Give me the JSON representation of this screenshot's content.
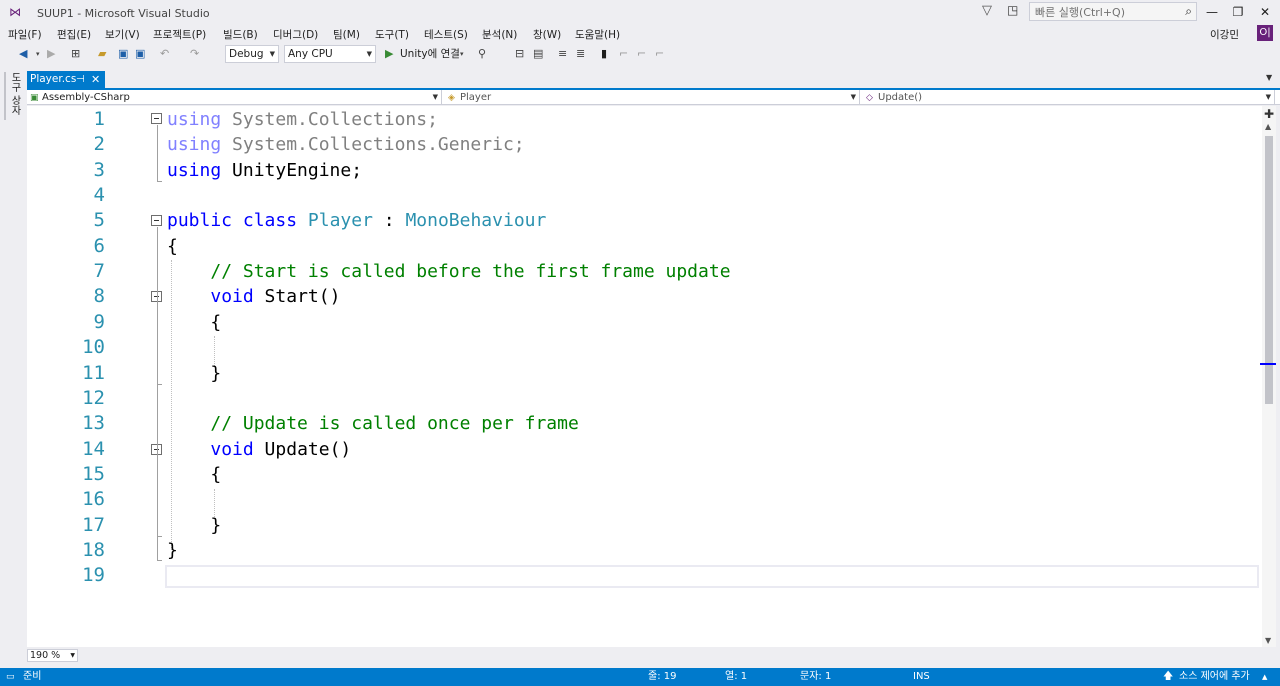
{
  "window": {
    "title": "SUUP1 - Microsoft Visual Studio",
    "quick_launch_placeholder": "빠른 실행(Ctrl+Q)",
    "minimize": "—",
    "restore": "❐",
    "close": "✕"
  },
  "menu": {
    "items": [
      "파일(F)",
      "편집(E)",
      "보기(V)",
      "프로젝트(P)",
      "빌드(B)",
      "디버그(D)",
      "팀(M)",
      "도구(T)",
      "테스트(S)",
      "분석(N)",
      "창(W)",
      "도움말(H)"
    ],
    "user": "이강민",
    "avatar": "O|"
  },
  "toolbar": {
    "config": "Debug",
    "platform": "Any CPU",
    "run_label": "Unity에 연결"
  },
  "sidebar": {
    "label": "도구 상자"
  },
  "tab": {
    "label": "Player.cs",
    "pin": "⊣",
    "close": "✕"
  },
  "nav": {
    "project": "Assembly-CSharp",
    "type": "Player",
    "member": "Update()"
  },
  "editor": {
    "line_numbers": [
      "1",
      "2",
      "3",
      "4",
      "5",
      "6",
      "7",
      "8",
      "9",
      "10",
      "11",
      "12",
      "13",
      "14",
      "15",
      "16",
      "17",
      "18",
      "19"
    ],
    "lines": [
      [
        {
          "t": "using",
          "c": "dimkw"
        },
        {
          "t": " System.Collections;",
          "c": "dim"
        }
      ],
      [
        {
          "t": "using",
          "c": "dimkw"
        },
        {
          "t": " System.Collections.Generic;",
          "c": "dim"
        }
      ],
      [
        {
          "t": "using",
          "c": "kw"
        },
        {
          "t": " UnityEngine;",
          "c": "pl"
        }
      ],
      [],
      [
        {
          "t": "public",
          "c": "kw"
        },
        {
          "t": " ",
          "c": "pl"
        },
        {
          "t": "class",
          "c": "kw"
        },
        {
          "t": " ",
          "c": "pl"
        },
        {
          "t": "Player",
          "c": "ty"
        },
        {
          "t": " : ",
          "c": "pl"
        },
        {
          "t": "MonoBehaviour",
          "c": "ty"
        }
      ],
      [
        {
          "t": "{",
          "c": "pl"
        }
      ],
      [
        {
          "t": "    ",
          "c": "pl"
        },
        {
          "t": "// Start is called before the first frame update",
          "c": "cm"
        }
      ],
      [
        {
          "t": "    ",
          "c": "pl"
        },
        {
          "t": "void",
          "c": "kw"
        },
        {
          "t": " Start()",
          "c": "pl"
        }
      ],
      [
        {
          "t": "    {",
          "c": "pl"
        }
      ],
      [],
      [
        {
          "t": "    }",
          "c": "pl"
        }
      ],
      [],
      [
        {
          "t": "    ",
          "c": "pl"
        },
        {
          "t": "// Update is called once per frame",
          "c": "cm"
        }
      ],
      [
        {
          "t": "    ",
          "c": "pl"
        },
        {
          "t": "void",
          "c": "kw"
        },
        {
          "t": " Update()",
          "c": "pl"
        }
      ],
      [
        {
          "t": "    {",
          "c": "pl"
        }
      ],
      [],
      [
        {
          "t": "    }",
          "c": "pl"
        }
      ],
      [
        {
          "t": "}",
          "c": "pl"
        }
      ],
      []
    ]
  },
  "zoom": "190 %",
  "status": {
    "ready": "준비",
    "line": "줄: 19",
    "col": "열: 1",
    "ch": "문자: 1",
    "mode": "INS",
    "source_control": "소스 제어에 추가"
  }
}
